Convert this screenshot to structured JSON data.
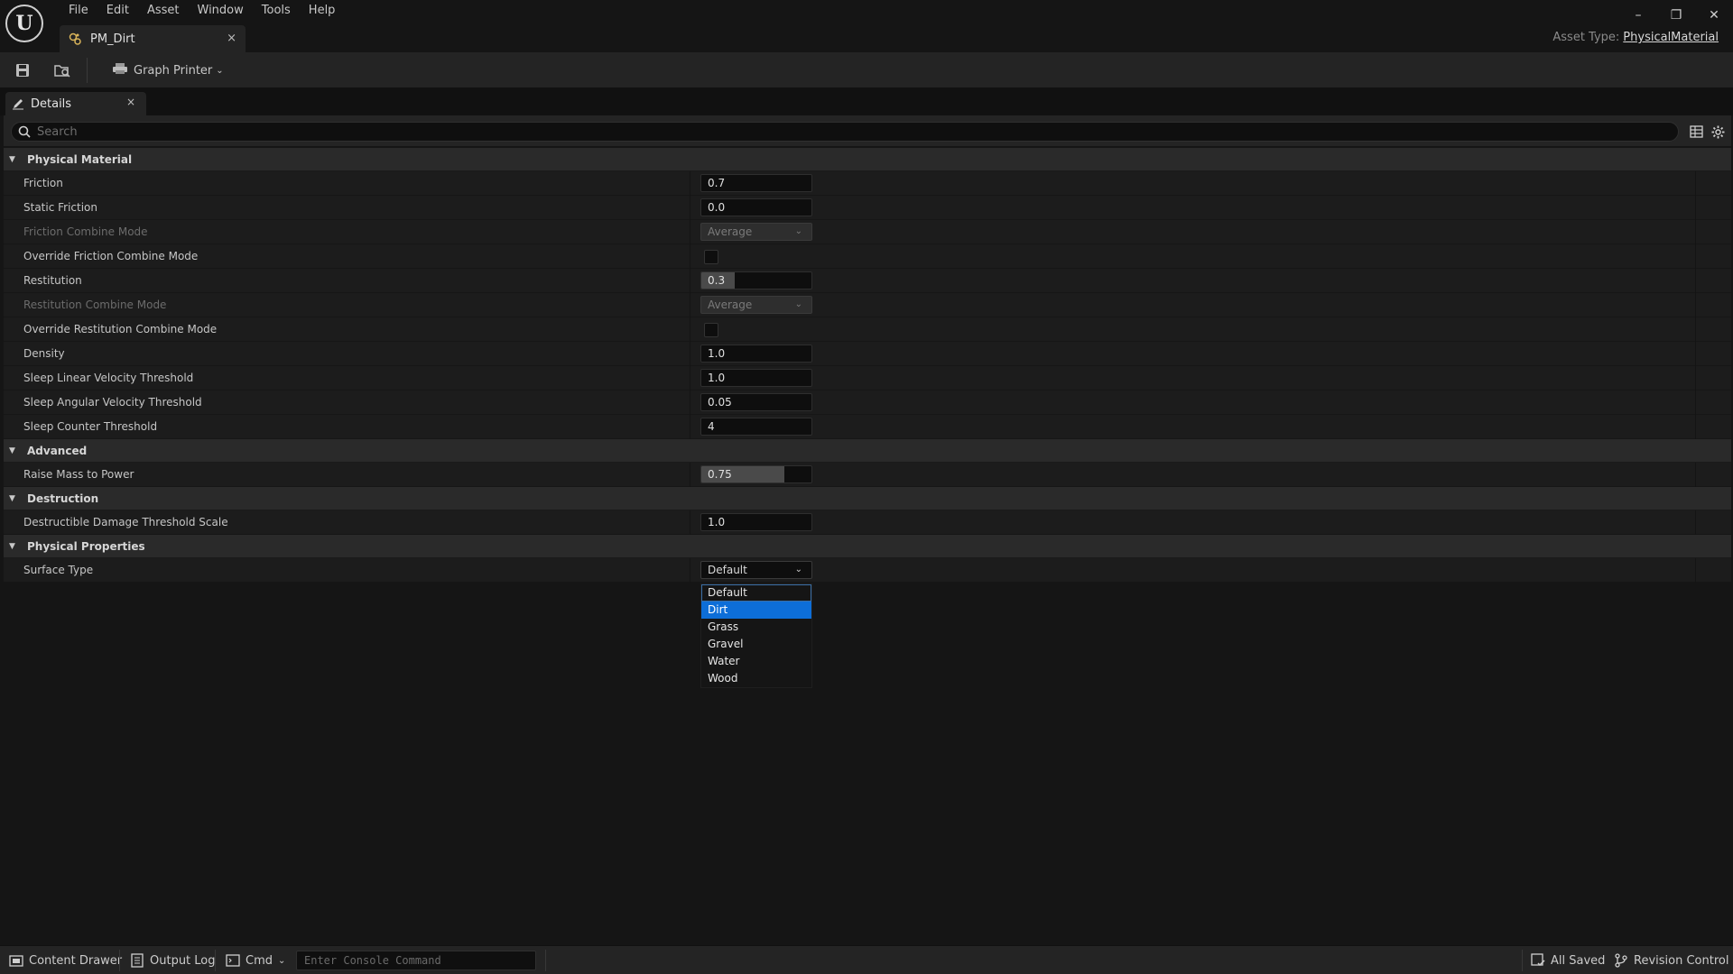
{
  "app": {
    "menu": [
      "File",
      "Edit",
      "Asset",
      "Window",
      "Tools",
      "Help"
    ],
    "document_tab": "PM_Dirt",
    "tab_close": "×",
    "asset_type_label": "Asset Type:",
    "asset_type_value": "PhysicalMaterial",
    "window_controls": {
      "minimize": "–",
      "restore": "❐",
      "close": "✕"
    }
  },
  "toolbar": {
    "graph_printer_label": "Graph Printer",
    "chevron": "⌄"
  },
  "details": {
    "tab_label": "Details",
    "tab_close": "×",
    "search_placeholder": "Search"
  },
  "categories": {
    "physical_material": {
      "label": "Physical Material",
      "props": {
        "friction": {
          "label": "Friction",
          "value": "0.7"
        },
        "static_friction": {
          "label": "Static Friction",
          "value": "0.0"
        },
        "friction_combine_mode": {
          "label": "Friction Combine Mode",
          "value": "Average"
        },
        "override_friction_combine_mode": {
          "label": "Override Friction Combine Mode",
          "checked": false
        },
        "restitution": {
          "label": "Restitution",
          "value": "0.3",
          "fill": 0.3
        },
        "restitution_combine_mode": {
          "label": "Restitution Combine Mode",
          "value": "Average"
        },
        "override_restitution_combine_mode": {
          "label": "Override Restitution Combine Mode",
          "checked": false
        },
        "density": {
          "label": "Density",
          "value": "1.0"
        },
        "sleep_linear_velocity_threshold": {
          "label": "Sleep Linear Velocity Threshold",
          "value": "1.0"
        },
        "sleep_angular_velocity_threshold": {
          "label": "Sleep Angular Velocity Threshold",
          "value": "0.05"
        },
        "sleep_counter_threshold": {
          "label": "Sleep Counter Threshold",
          "value": "4"
        }
      }
    },
    "advanced": {
      "label": "Advanced",
      "props": {
        "raise_mass_to_power": {
          "label": "Raise Mass to Power",
          "value": "0.75",
          "fill": 0.75
        }
      }
    },
    "destruction": {
      "label": "Destruction",
      "props": {
        "destructible_damage_threshold_scale": {
          "label": "Destructible Damage Threshold Scale",
          "value": "1.0"
        }
      }
    },
    "physical_properties": {
      "label": "Physical Properties",
      "props": {
        "surface_type": {
          "label": "Surface Type",
          "value": "Default"
        }
      }
    }
  },
  "surface_type_options": [
    "Default",
    "Dirt",
    "Grass",
    "Gravel",
    "Water",
    "Wood"
  ],
  "surface_type_highlighted": "Dirt",
  "statusbar": {
    "content_drawer": "Content Drawer",
    "output_log": "Output Log",
    "cmd": "Cmd",
    "console_placeholder": "Enter Console Command",
    "all_saved": "All Saved",
    "revision_control": "Revision Control"
  },
  "colors": {
    "accent_selection": "#0d6ed8",
    "background": "#151515",
    "panel": "#242424"
  }
}
